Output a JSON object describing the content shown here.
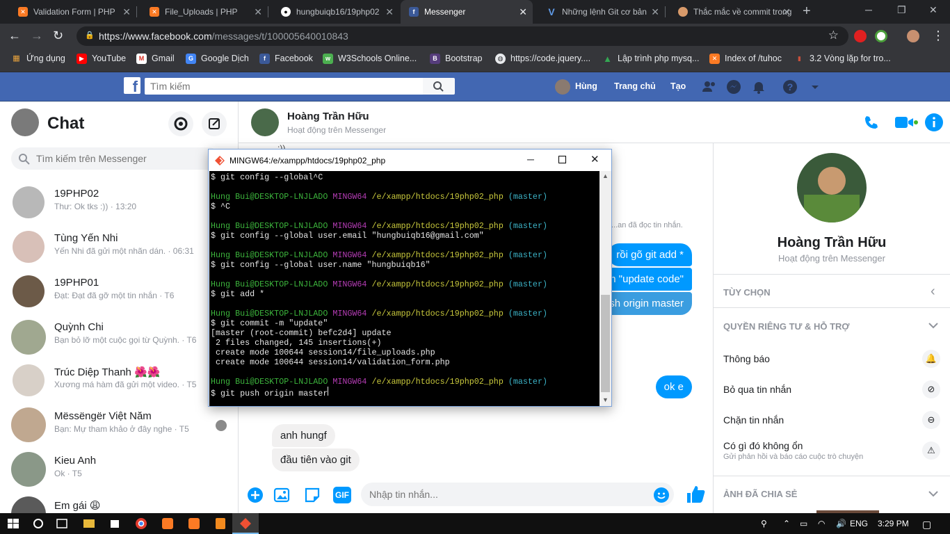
{
  "browser": {
    "tabs": [
      {
        "title": "Validation Form | PHP",
        "icon": "xampp-icon",
        "active": false
      },
      {
        "title": "File_Uploads | PHP",
        "icon": "xampp-icon",
        "active": false
      },
      {
        "title": "hungbuiqb16/19php02",
        "icon": "github-icon",
        "active": false
      },
      {
        "title": "Messenger",
        "icon": "facebook-icon",
        "active": true
      },
      {
        "title": "Những lệnh Git cơ bản",
        "icon": "viblo-icon",
        "active": false
      },
      {
        "title": "Thắc mắc về commit trong",
        "icon": "avatar-icon",
        "active": false
      }
    ],
    "url_host": "https://www.facebook.com",
    "url_path": "/messages/t/100005640010843",
    "bookmarks": [
      {
        "label": "Ứng dụng",
        "icon": "apps-icon"
      },
      {
        "label": "YouTube",
        "icon": "youtube-icon"
      },
      {
        "label": "Gmail",
        "icon": "gmail-icon"
      },
      {
        "label": "Google Dịch",
        "icon": "translate-icon"
      },
      {
        "label": "Facebook",
        "icon": "facebook-icon"
      },
      {
        "label": "W3Schools Online...",
        "icon": "w3schools-icon"
      },
      {
        "label": "Bootstrap",
        "icon": "bootstrap-icon"
      },
      {
        "label": "https://code.jquery....",
        "icon": "globe-icon"
      },
      {
        "label": "Lập trình php mysq...",
        "icon": "drive-icon"
      },
      {
        "label": "Index of /tuhoc",
        "icon": "xampp-icon"
      },
      {
        "label": "3.2 Vòng lặp for tro...",
        "icon": "bookmark-icon"
      }
    ]
  },
  "facebook": {
    "search_placeholder": "Tìm kiếm",
    "user_name": "Hùng",
    "home_label": "Trang chủ",
    "create_label": "Tạo"
  },
  "messenger": {
    "title": "Chat",
    "search_placeholder": "Tìm kiếm trên Messenger",
    "conversations": [
      {
        "name": "19PHP02",
        "snippet": "Thư: Ok tks :)) · 13:20"
      },
      {
        "name": "Tùng Yến Nhi",
        "snippet": "Yến Nhi đã gửi một nhãn dán. · 06:31"
      },
      {
        "name": "19PHP01",
        "snippet": "Đạt: Đạt đã gỡ một tin nhắn · T6"
      },
      {
        "name": "Quỳnh Chi",
        "snippet": "Bạn bỏ lỡ một cuộc gọi từ Quỳnh. · T6"
      },
      {
        "name": "Trúc Diệp Thanh 🌺🌺",
        "snippet": "Xương má hàm đã gửi một video. · T5"
      },
      {
        "name": "Mëssëngër Việt Năm",
        "snippet": "Bạn: Mự tham khảo ở đây nghe · T5"
      },
      {
        "name": "Kieu Anh",
        "snippet": "Ok · T5"
      },
      {
        "name": "Em gái 😩",
        "snippet": ""
      }
    ],
    "contact": {
      "name": "Hoàng Trần Hữu",
      "status": "Hoạt động trên Messenger"
    },
    "messages": {
      "top_emote": ":))",
      "seen_text": "...an đã đọc tin nhắn.",
      "out": [
        "rồi gõ git add *",
        "n \"update code\"",
        "sh origin master",
        "ok e"
      ],
      "in": [
        "anh hungf",
        "đầu tiên vào git"
      ]
    },
    "composer_placeholder": "Nhập tin nhắn...",
    "gif_label": "GIF",
    "info": {
      "options_title": "TÙY CHỌN",
      "privacy_title": "QUYỀN RIÊNG TƯ & HỖ TRỢ",
      "notifications": "Thông báo",
      "ignore": "Bỏ qua tin nhắn",
      "block": "Chặn tin nhắn",
      "report": "Có gì đó không ổn",
      "report_sub": "Gửi phản hồi và báo cáo cuộc trò chuyện",
      "shared_photos": "ẢNH ĐÃ CHIA SẺ"
    }
  },
  "terminal": {
    "title": "MINGW64:/e/xampp/htdocs/19php02_php",
    "prompt_user": "Hung Bui@DESKTOP-LNJLADO",
    "prompt_sys": "MINGW64",
    "prompt_path": "/e/xampp/htdocs/19php02_php",
    "prompt_branch": "(master)",
    "first_line": "$ git config --global^C",
    "blocks": [
      [
        "$ ^C"
      ],
      [
        "$ git config --global user.email \"hungbuiqb16@gmail.com\""
      ],
      [
        "$ git config --global user.name \"hungbuiqb16\""
      ],
      [
        "$ git add *"
      ],
      [
        "$ git commit -m \"update\"",
        "[master (root-commit) befc2d4] update",
        " 2 files changed, 145 insertions(+)",
        " create mode 100644 session14/file_uploads.php",
        " create mode 100644 session14/validation_form.php"
      ],
      [
        "$ git push origin master"
      ]
    ]
  },
  "taskbar": {
    "lang": "ENG",
    "time": "3:29 PM"
  }
}
